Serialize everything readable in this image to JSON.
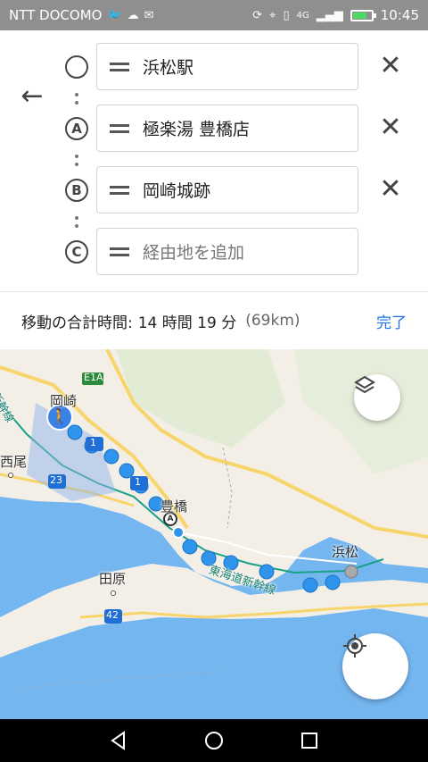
{
  "status_bar": {
    "carrier": "NTT DOCOMO",
    "network": "4G",
    "time": "10:45"
  },
  "route": {
    "stops": [
      {
        "marker": "",
        "value": "浜松駅",
        "placeholder": false,
        "removable": true
      },
      {
        "marker": "A",
        "value": "極楽湯 豊橋店",
        "placeholder": false,
        "removable": true
      },
      {
        "marker": "B",
        "value": "岡崎城跡",
        "placeholder": false,
        "removable": true
      },
      {
        "marker": "C",
        "value": "経由地を追加",
        "placeholder": true,
        "removable": false
      }
    ]
  },
  "summary": {
    "label": "移動の合計時間:",
    "time": "14 時間 19 分",
    "distance": "(69km)",
    "done_label": "完了"
  },
  "map": {
    "labels": {
      "okazaki": "岡崎",
      "nishio": "西尾",
      "toyohashi": "豊橋",
      "tahara": "田原",
      "hamamatsu": "浜松",
      "shinkansen": "東海道新幹線",
      "shinkansen_top": "新幹線"
    },
    "route_shields": {
      "e1a": "E1A",
      "r23": "23",
      "r42": "42",
      "r1a": "1",
      "r1b": "1"
    },
    "waypoint_marker": "A",
    "colors": {
      "sea": "#74b6f0",
      "land": "#f3efe6",
      "route_dot": "#2f95ec",
      "rail": "#1aa089"
    }
  }
}
